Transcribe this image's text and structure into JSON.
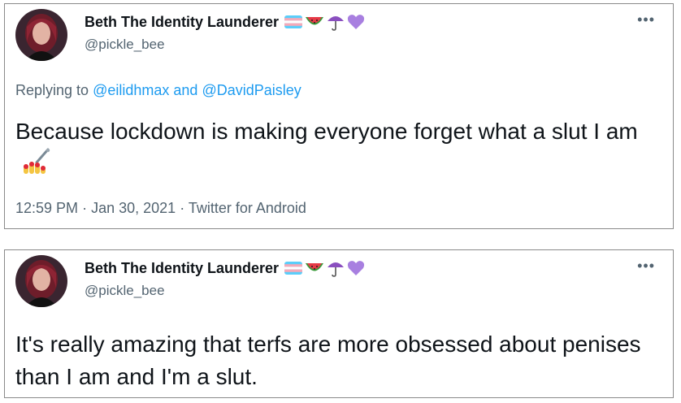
{
  "tweets": [
    {
      "display_name": "Beth The Identity Launderer",
      "handle": "@pickle_bee",
      "more_label": "•••",
      "name_emojis": [
        "trans-flag-icon",
        "watermelon-icon",
        "umbrella-icon",
        "purple-heart-icon"
      ],
      "replying_prefix": "Replying to",
      "replying_to_1": "@eilidhmax",
      "replying_and": "and",
      "replying_to_2": "@DavidPaisley",
      "text": "Because lockdown is making everyone forget what a slut I am",
      "text_emoji": "nail-polish-icon",
      "time": "12:59 PM",
      "sep": "·",
      "date": "Jan 30, 2021",
      "source": "Twitter for Android"
    },
    {
      "display_name": "Beth The Identity Launderer",
      "handle": "@pickle_bee",
      "more_label": "•••",
      "name_emojis": [
        "trans-flag-icon",
        "watermelon-icon",
        "umbrella-icon",
        "purple-heart-icon"
      ],
      "text": "It's really amazing that terfs are more obsessed about penises than I am and I'm a slut."
    }
  ],
  "colors": {
    "link": "#1d9bf0",
    "secondary_text": "#536471",
    "primary_text": "#0f1419",
    "border": "#8a8a8a"
  }
}
